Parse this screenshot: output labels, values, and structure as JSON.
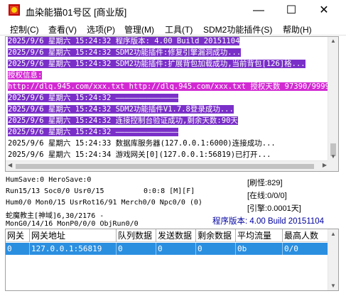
{
  "window": {
    "title": "血染能猫01号区 [商业版]",
    "minimize_glyph": "—",
    "maximize_glyph": "☐",
    "close_glyph": "✕"
  },
  "menu": [
    {
      "label": "控制(C)"
    },
    {
      "label": "查看(V)"
    },
    {
      "label": "选项(P)"
    },
    {
      "label": "管理(M)"
    },
    {
      "label": "工具(T)"
    },
    {
      "label": "SDM2功能插件(S)"
    },
    {
      "label": "帮助(H)"
    }
  ],
  "log": [
    {
      "text": "2025/9/6  星期六 15:24:32 程序版本: 4.00 Build 20151104",
      "style": "hl-blue"
    },
    {
      "text": "2025/9/6  星期六 15:24:32 SDM2功能插件:修复引擎漏洞成功...",
      "style": "hl-blue"
    },
    {
      "text": "2025/9/6  星期六 15:24:32 SDM2功能插件:扩展背包加载成功,当前背包[126]格...",
      "style": "hl-blue"
    },
    {
      "text": "授权信息:",
      "style": "hl-magenta"
    },
    {
      "text": "http://dlq.945.com/xxx.txt http://dlq.945.com/xxx.txt 授权天数 97390/99999",
      "style": "hl-magenta"
    },
    {
      "text": "2025/9/6  星期六 15:24:32 ——————————————",
      "style": "hl-blue"
    },
    {
      "text": "2025/9/6  星期六 15:24:32 SDM2功能插件V1.7.8登录成功...",
      "style": "hl-blue"
    },
    {
      "text": "2025/9/6  星期六 15:24:32 连接控制台验证成功,剩余天数:90天",
      "style": "hl-blue"
    },
    {
      "text": "2025/9/6  星期六 15:24:32 ——————————————",
      "style": "hl-blue"
    },
    {
      "text": "2025/9/6  星期六 15:24:33 数据库服务器(127.0.0.1:6000)连接成功...",
      "style": "plain"
    },
    {
      "text": "2025/9/6  星期六 15:24:34 游戏网关[0](127.0.0.1:56819)已打开...",
      "style": "plain"
    }
  ],
  "status": {
    "line1": "HumSave:0 HeroSave:0",
    "line2": "Run15/13 Soc0/0 Usr0/15",
    "line2_mid": "0:0:8 [M][F]",
    "line3": "Hum0/0 Mon0/15 UsrRot16/91 Merch0/0 Npc0/0 (0)",
    "line4": "蛇魔教主[神域]6,30/2176 -",
    "line5": "MonG0/14/16 MonP0/0/0 ObjRun0/0",
    "refresh": "[刷怪:829]",
    "online": "[在线:0/0/0]",
    "engine": "[引擎:0.0001天]",
    "version": "程序版本: 4.00 Build 20151104"
  },
  "table": {
    "columns": [
      "网关",
      "网关地址",
      "队列数据",
      "发送数据",
      "剩余数据",
      "平均流量",
      "最高人数"
    ],
    "rows": [
      [
        "0",
        "127.0.0.1:56819",
        "0",
        "0",
        "0",
        "0b",
        "0/0"
      ]
    ]
  },
  "colors": {
    "log_highlight": "#7a30c8",
    "log_auth": "#d22ad2",
    "row_selected": "#2b8fe0",
    "version_text": "#0000a0"
  }
}
